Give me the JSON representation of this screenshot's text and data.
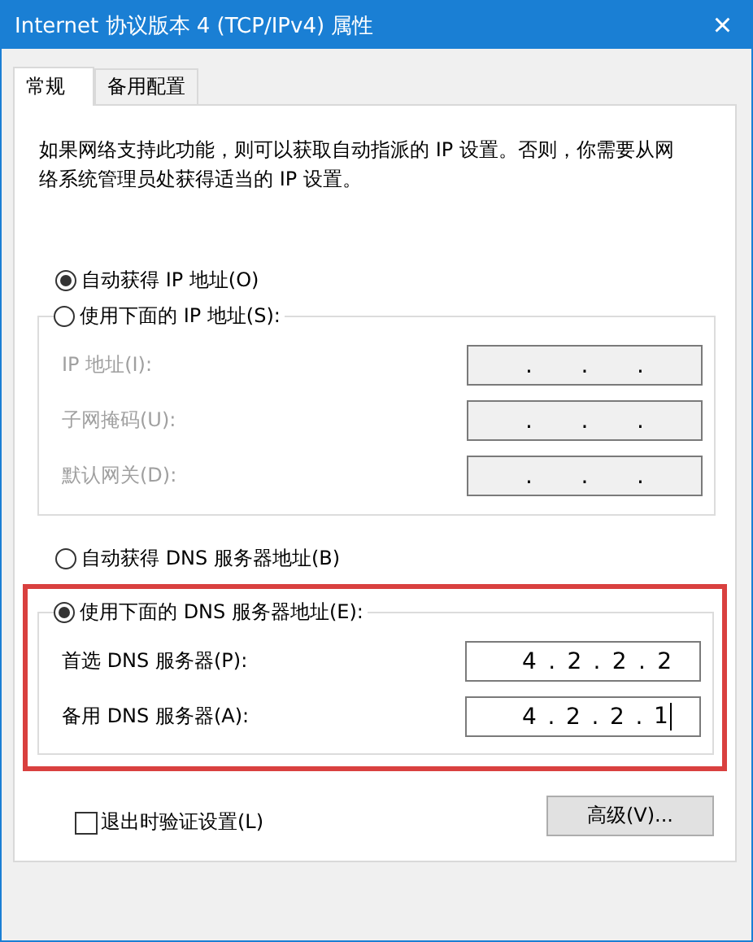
{
  "window": {
    "title": "Internet 协议版本 4 (TCP/IPv4) 属性",
    "close": "×"
  },
  "tabs": [
    {
      "label": "常规",
      "selected": true
    },
    {
      "label": "备用配置",
      "selected": false
    }
  ],
  "description": "如果网络支持此功能，则可以获取自动指派的 IP 设置。否则，你需要从网络系统管理员处获得适当的 IP 设置。",
  "ip_section": {
    "auto_option": {
      "label": "自动获得 IP 地址(O)",
      "selected": true
    },
    "manual_option": {
      "label": "使用下面的 IP 地址(S):",
      "selected": false
    },
    "disabled": true,
    "fields": [
      {
        "label": "IP 地址(I):",
        "parts": [
          ".",
          ".",
          "."
        ]
      },
      {
        "label": "子网掩码(U):",
        "parts": [
          ".",
          ".",
          "."
        ]
      },
      {
        "label": "默认网关(D):",
        "parts": [
          ".",
          ".",
          "."
        ]
      }
    ]
  },
  "dns_section": {
    "auto_option": {
      "label": "自动获得 DNS 服务器地址(B)",
      "selected": false
    },
    "manual_option": {
      "label": "使用下面的 DNS 服务器地址(E):",
      "selected": true
    },
    "highlighted": true,
    "fields": [
      {
        "label": "首选 DNS 服务器(P):",
        "parts": [
          "4",
          ".",
          "2",
          ".",
          "2",
          ".",
          "2"
        ]
      },
      {
        "label": "备用 DNS 服务器(A):",
        "parts": [
          "4",
          ".",
          "2",
          ".",
          "2",
          ".",
          "1"
        ],
        "focused": true
      }
    ]
  },
  "validate_on_exit": {
    "label": "退出时验证设置(L)",
    "checked": false
  },
  "advanced_button": "高级(V)..."
}
